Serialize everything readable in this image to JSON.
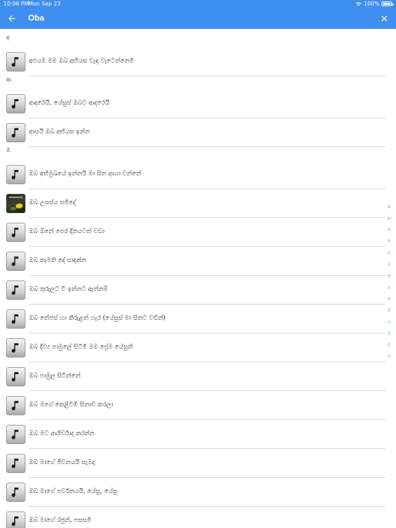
{
  "status_bar": {
    "time": "10:06 PM",
    "date": "Mon Sep 23",
    "battery": "100%",
    "wifi_icon": "wifi-icon",
    "battery_icon": "battery-icon"
  },
  "app_bar": {
    "title": "Oba",
    "back_icon": "arrow-back-icon",
    "close_icon": "close-icon",
    "color": "#3f8ff0"
  },
  "sections": [
    {
      "header": "අ",
      "items": [
        {
          "label": "අඑයම මම ඔබ අභියස වැඳ වැටෙන්නෙමි",
          "art": false
        }
      ]
    },
    {
      "header": "ආ",
      "items": [
        {
          "label": "ආදරෙයි, යේසුස් ඔබට ආදරෙයි",
          "art": false
        },
        {
          "label": "ආසයි ඔබ අභියස ඉන්න",
          "art": false
        }
      ]
    },
    {
      "header": "ඔ",
      "items": [
        {
          "label": "ඔබ අභිමුඛයේ ඉන්නයි මා සිත ආශා වන්නේ",
          "art": false
        },
        {
          "label": "ඔබ උසස්ය සමිදේ",
          "art": true
        },
        {
          "label": "ඔබ ඕනේ පෙර දිනයටත් වඩා",
          "art": false
        },
        {
          "label": "ඔබ කැමති දේ සාදන්න",
          "art": false
        },
        {
          "label": "ඔබ තුරුලට වී ඉන්නට ඇත්නම්",
          "art": false
        },
        {
          "label": "ඔබ තේජස් හා කිරුළත් හැර (යේසුස් මා සිතට වඩින්)",
          "art": false
        },
        {
          "label": "ඔබ දිව්‍ය පාමුලේ සිටිමි මම ප්‍රේම යේසුනි",
          "art": false
        },
        {
          "label": "ඔබ පාමුල සිටින්නේ",
          "art": false
        },
        {
          "label": "ඔබ මගේ කෙළිවිමි සිතාව කරලා",
          "art": false
        },
        {
          "label": "ඔබ මට ආශිර්වාද කරන්න",
          "art": false
        },
        {
          "label": "ඔබ මාගේ ජීවනයයි සැමදා",
          "art": false
        },
        {
          "label": "ඔබ මාගේ පර්වතයයි, යේසු, යේසු",
          "art": false
        },
        {
          "label": "ඔබ මාගේ රජුන්, පසසමි",
          "art": false
        }
      ]
    }
  ],
  "index_letters": [
    "අ",
    "ආ",
    "ඔ",
    "ප",
    "ග",
    "ද",
    "ත",
    "ස",
    "ප",
    "ම",
    "ය",
    "ව",
    "ව",
    "ප"
  ],
  "song_icon": "music-note-icon"
}
